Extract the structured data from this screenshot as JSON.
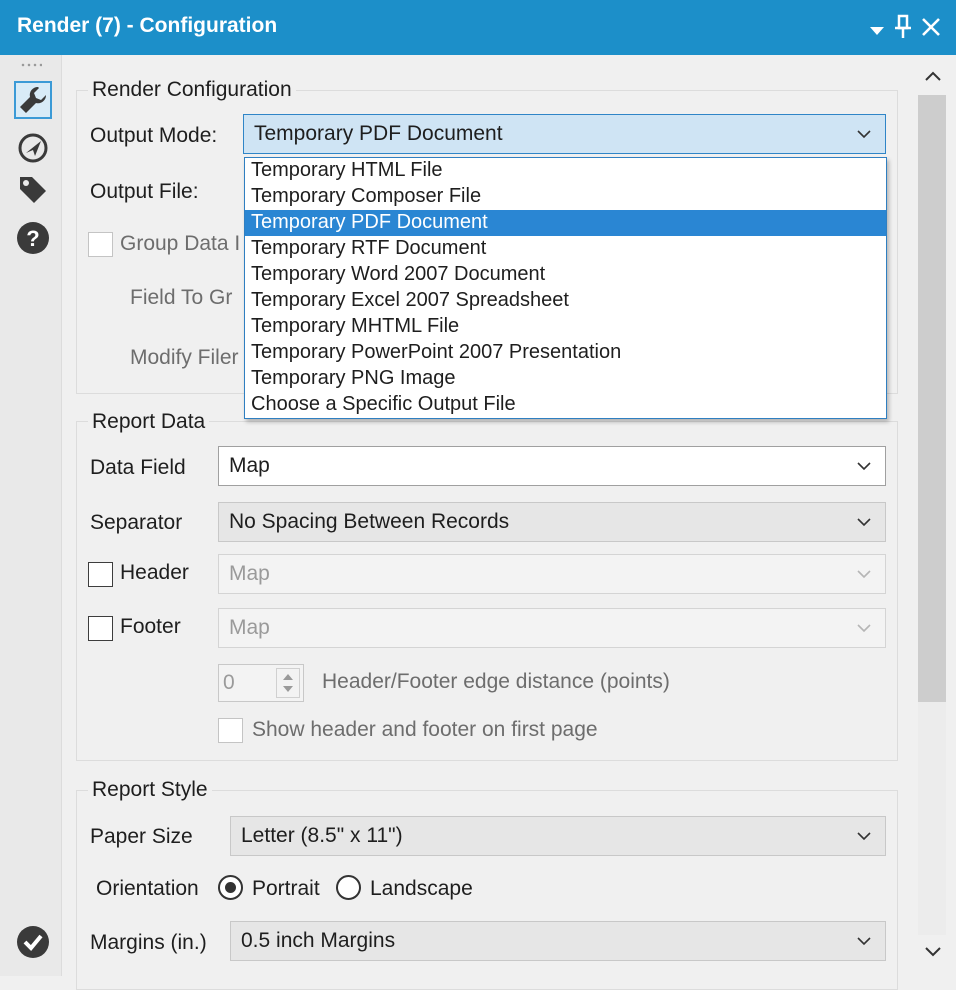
{
  "window": {
    "title": "Render (7) - Configuration",
    "buttons": [
      "dropdown-arrow",
      "pin",
      "close"
    ]
  },
  "left_toolbar": {
    "icons": [
      "wrench-icon",
      "navigation-icon",
      "tag-icon",
      "help-icon",
      "check-circle-icon"
    ]
  },
  "render_configuration": {
    "legend": "Render Configuration",
    "output_mode_label": "Output Mode:",
    "output_mode_value": "Temporary PDF Document",
    "output_file_label": "Output File:",
    "group_data_label": "Group Data I",
    "field_to_group_label": "Field To Gr",
    "modify_filename_label": "Modify Filer",
    "dropdown_options": [
      "Temporary HTML File",
      "Temporary Composer File",
      "Temporary PDF Document",
      "Temporary RTF Document",
      "Temporary Word 2007 Document",
      "Temporary Excel 2007 Spreadsheet",
      "Temporary MHTML File",
      "Temporary PowerPoint 2007 Presentation",
      "Temporary PNG Image",
      "Choose a Specific Output File"
    ]
  },
  "report_data": {
    "legend": "Report Data",
    "data_field_label": "Data Field",
    "data_field_value": "Map",
    "separator_label": "Separator",
    "separator_value": "No Spacing Between Records",
    "header_label": "Header",
    "header_value": "Map",
    "footer_label": "Footer",
    "footer_value": "Map",
    "edge_distance_value": "0",
    "edge_distance_label": "Header/Footer edge distance (points)",
    "show_first_page_label": "Show header and footer on first page"
  },
  "report_style": {
    "legend": "Report Style",
    "paper_size_label": "Paper Size",
    "paper_size_value": "Letter (8.5\" x 11\")",
    "orientation_label": "Orientation",
    "portrait_label": "Portrait",
    "landscape_label": "Landscape",
    "orientation_selected": "Portrait",
    "margins_label": "Margins (in.)",
    "margins_value": "0.5 inch Margins"
  },
  "colors": {
    "titlebar": "#1c8fc9",
    "selection": "#2a86d3",
    "background": "#f0f0f0"
  }
}
